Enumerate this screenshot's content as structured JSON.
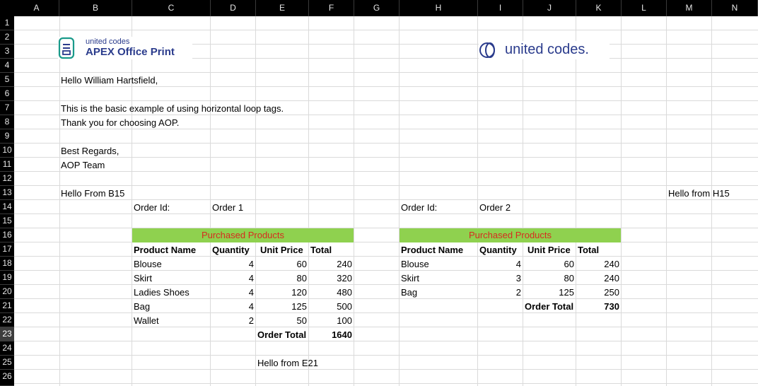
{
  "columns": [
    "A",
    "B",
    "C",
    "D",
    "E",
    "F",
    "G",
    "H",
    "I",
    "J",
    "K",
    "L",
    "M",
    "N"
  ],
  "rows": [
    "1",
    "2",
    "3",
    "4",
    "5",
    "6",
    "7",
    "8",
    "9",
    "10",
    "11",
    "12",
    "13",
    "14",
    "15",
    "16",
    "17",
    "18",
    "19",
    "20",
    "21",
    "22",
    "23",
    "24",
    "25",
    "26"
  ],
  "selected_row": "23",
  "logos": {
    "aop_small": "united codes",
    "aop_big": "APEX Office Print",
    "uc": "united codes."
  },
  "letter": {
    "greeting": "Hello William Hartsfield,",
    "line1": "This is the basic example of using horizontal loop tags.",
    "line2": "Thank you for choosing AOP.",
    "closing": "Best Regards,",
    "team": "AOP Team"
  },
  "notes": {
    "b15": "Hello From B15",
    "h15": "Hello from H15",
    "e21": "Hello from E21"
  },
  "order1": {
    "id_label": "Order Id:",
    "id_value": "Order 1",
    "band": "Purchased Products",
    "headers": [
      "Product Name",
      "Quantity",
      "Unit Price",
      "Total"
    ],
    "rows": [
      [
        "Blouse",
        "4",
        "60",
        "240"
      ],
      [
        "Skirt",
        "4",
        "80",
        "320"
      ],
      [
        "Ladies Shoes",
        "4",
        "120",
        "480"
      ],
      [
        "Bag",
        "4",
        "125",
        "500"
      ],
      [
        "Wallet",
        "2",
        "50",
        "100"
      ]
    ],
    "total_label": "Order Total",
    "total_value": "1640"
  },
  "order2": {
    "id_label": "Order Id:",
    "id_value": "Order 2",
    "band": "Purchased Products",
    "headers": [
      "Product Name",
      "Quantity",
      "Unit Price",
      "Total"
    ],
    "rows": [
      [
        "Blouse",
        "4",
        "60",
        "240"
      ],
      [
        "Skirt",
        "3",
        "80",
        "240"
      ],
      [
        "Bag",
        "2",
        "125",
        "250"
      ]
    ],
    "total_label": "Order Total",
    "total_value": "730"
  },
  "colors": {
    "band_bg": "#8fd14f",
    "band_text": "#d62b1f",
    "header_bg": "#000000",
    "logo_navy": "#2a3b8c",
    "logo_teal": "#1a9a8a"
  }
}
